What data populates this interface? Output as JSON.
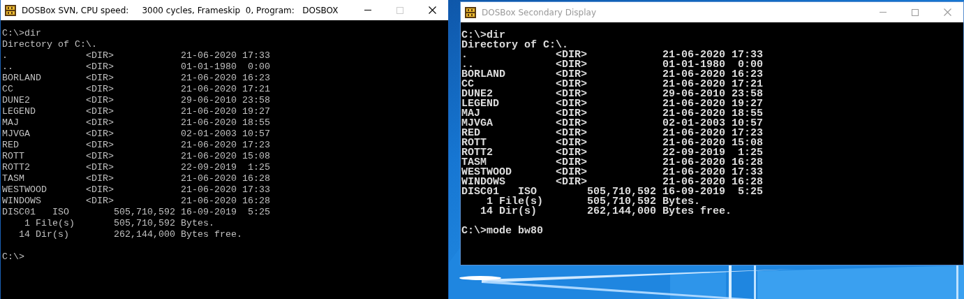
{
  "windows": [
    {
      "title": "DOSBox SVN, CPU speed:     3000 cycles, Frameskip  0, Program:   DOSBOX",
      "active": true,
      "maximize_disabled": true,
      "bold": false,
      "lines": [
        "C:\\>dir",
        "Directory of C:\\.",
        ".              <DIR>            21-06-2020 17:33",
        "..             <DIR>            01-01-1980  0:00",
        "BORLAND        <DIR>            21-06-2020 16:23",
        "CC             <DIR>            21-06-2020 17:21",
        "DUNE2          <DIR>            29-06-2010 23:58",
        "LEGEND         <DIR>            21-06-2020 19:27",
        "MAJ            <DIR>            21-06-2020 18:55",
        "MJVGA          <DIR>            02-01-2003 10:57",
        "RED            <DIR>            21-06-2020 17:23",
        "ROTT           <DIR>            21-06-2020 15:08",
        "ROTT2          <DIR>            22-09-2019  1:25",
        "TASM           <DIR>            21-06-2020 16:28",
        "WESTWOOD       <DIR>            21-06-2020 17:33",
        "WINDOWS        <DIR>            21-06-2020 16:28",
        "DISC01   ISO        505,710,592 16-09-2019  5:25",
        "    1 File(s)       505,710,592 Bytes.",
        "   14 Dir(s)        262,144,000 Bytes free."
      ],
      "prompt": "C:\\>"
    },
    {
      "title": "DOSBox Secondary Display",
      "active": false,
      "maximize_disabled": false,
      "bold": true,
      "lines": [
        "C:\\>dir",
        "Directory of C:\\.",
        ".              <DIR>            21-06-2020 17:33",
        "..             <DIR>            01-01-1980  0:00",
        "BORLAND        <DIR>            21-06-2020 16:23",
        "CC             <DIR>            21-06-2020 17:21",
        "DUNE2          <DIR>            29-06-2010 23:58",
        "LEGEND         <DIR>            21-06-2020 19:27",
        "MAJ            <DIR>            21-06-2020 18:55",
        "MJVGA          <DIR>            02-01-2003 10:57",
        "RED            <DIR>            21-06-2020 17:23",
        "ROTT           <DIR>            21-06-2020 15:08",
        "ROTT2          <DIR>            22-09-2019  1:25",
        "TASM           <DIR>            21-06-2020 16:28",
        "WESTWOOD       <DIR>            21-06-2020 17:33",
        "WINDOWS        <DIR>            21-06-2020 16:28",
        "DISC01   ISO        505,710,592 16-09-2019  5:25",
        "    1 File(s)       505,710,592 Bytes.",
        "   14 Dir(s)        262,144,000 Bytes free."
      ],
      "prompt": "C:\\>mode bw80"
    }
  ]
}
